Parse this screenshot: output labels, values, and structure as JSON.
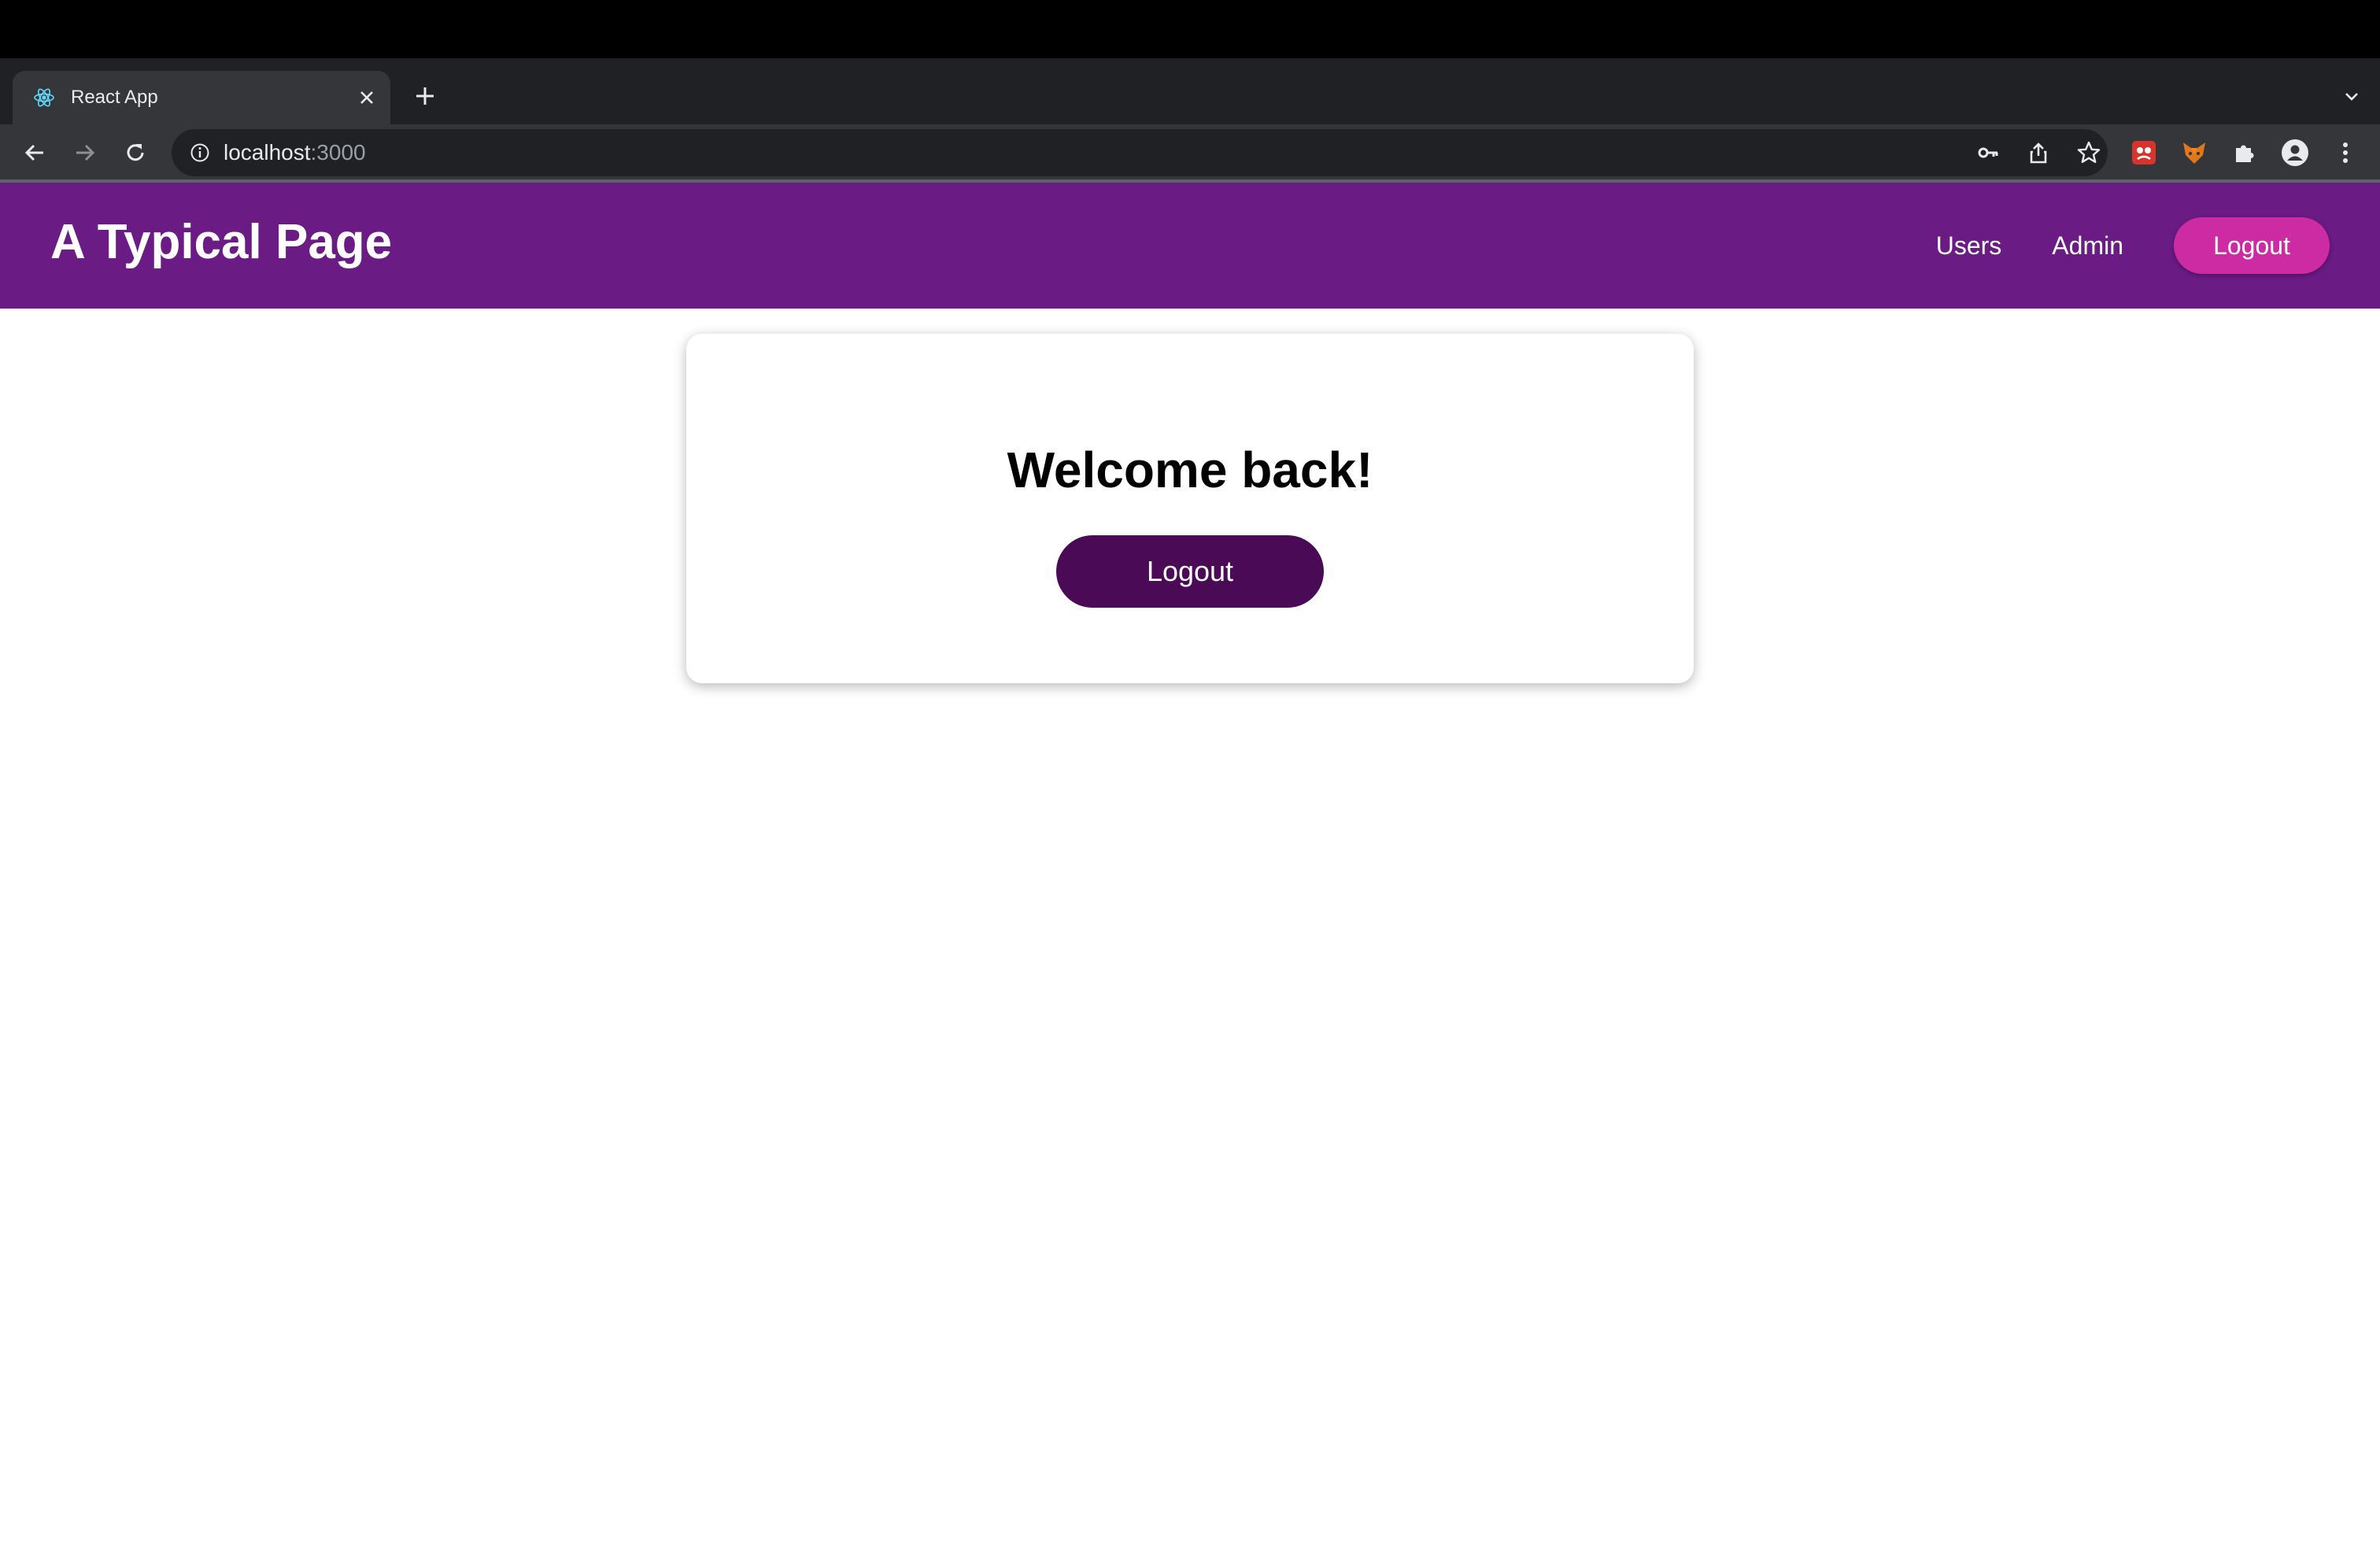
{
  "browser": {
    "tab": {
      "title": "React App",
      "favicon": "react-icon"
    },
    "url": {
      "host": "localhost",
      "port": ":3000"
    },
    "icons": [
      "back-icon",
      "forward-icon",
      "reload-icon",
      "info-icon",
      "key-icon",
      "share-icon",
      "star-icon",
      "extension-icon",
      "fox-icon",
      "puzzle-icon",
      "profile-icon",
      "menu-icon"
    ]
  },
  "header": {
    "title": "A Typical Page",
    "nav": {
      "users": "Users",
      "admin": "Admin",
      "logout": "Logout"
    },
    "background": "#6a1b84",
    "logout_color": "#cc2ba3"
  },
  "main": {
    "heading": "Welcome back!",
    "logout_label": "Logout",
    "button_color": "#4a0a55"
  }
}
